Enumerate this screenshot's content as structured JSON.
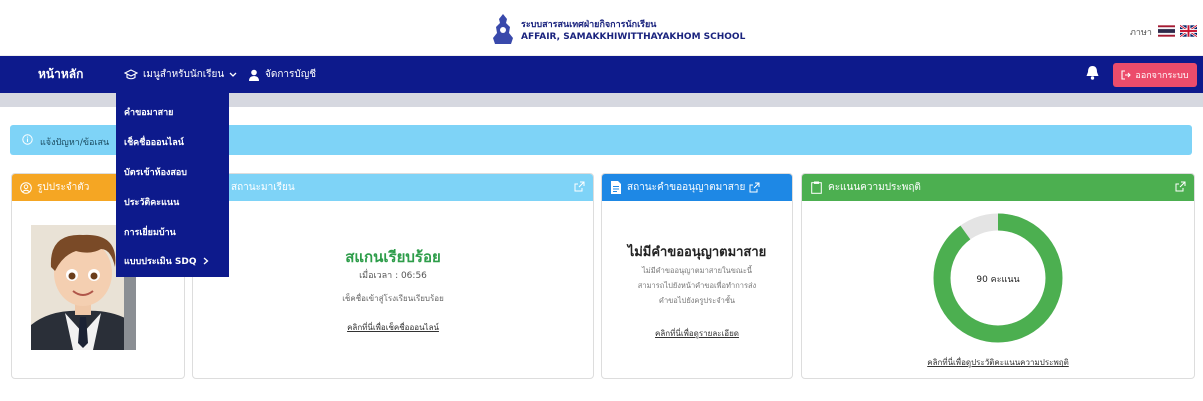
{
  "header": {
    "school_name_th": "ระบบสารสนเทศฝ่ายกิจการนักเรียน",
    "school_name_en": "AFFAIR, SAMAKKHIWITTHAYAKHOM SCHOOL",
    "lang_label": "ภาษา"
  },
  "nav": {
    "home": "หน้าหลัก",
    "student_menu": "เมนูสำหรับนักเรียน",
    "account": "จัดการบัญชี",
    "logout": "ออกจากระบบ"
  },
  "dropdown": {
    "items": [
      "คำขอมาสาย",
      "เช็คชื่อออนไลน์",
      "บัตรเข้าห้องสอบ",
      "ประวัติคะแนน",
      "การเยี่ยมบ้าน",
      "แบบประเมิน SDQ"
    ]
  },
  "alert": {
    "text": "แจ้งปัญหา/ข้อเสน"
  },
  "cards": {
    "profile": {
      "title": "รูปประจำตัว"
    },
    "status": {
      "title": "สถานะมาเรียน",
      "status": "สแกนเรียบร้อย",
      "time": "เมื่อเวลา : 06:56",
      "note": "เช็คชื่อเข้าสู่โรงเรียนเรียบร้อย",
      "link": "คลิกที่นี่เพื่อเช็คชื่อออนไลน์"
    },
    "leave": {
      "title": "สถานะคำขออนุญาตมาสาย",
      "status": "ไม่มีคำขออนุญาตมาสาย",
      "desc1": "ไม่มีคำขออนุญาตมาสายในขณะนี้",
      "desc2": "สามารถไปยังหน้าคำขอเพื่อทำการส่ง",
      "desc3": "คำขอไปยังครูประจำชั้น",
      "link": "คลิกที่นี่เพื่อดูรายละเอียด"
    },
    "behavior": {
      "title": "คะแนนความประพฤติ",
      "score": "90 คะแนน",
      "score_value": 90,
      "score_max": 100,
      "link": "คลิกที่นี่เพื่อดูประวัติคะแนนความประพฤติ"
    }
  },
  "colors": {
    "navbar": "#0d1a8c",
    "profile_head": "#f5a623",
    "info_head": "#7ed3f7",
    "leave_head": "#1e88e5",
    "behavior_head": "#4caf50",
    "logout": "#ec4c6b"
  }
}
